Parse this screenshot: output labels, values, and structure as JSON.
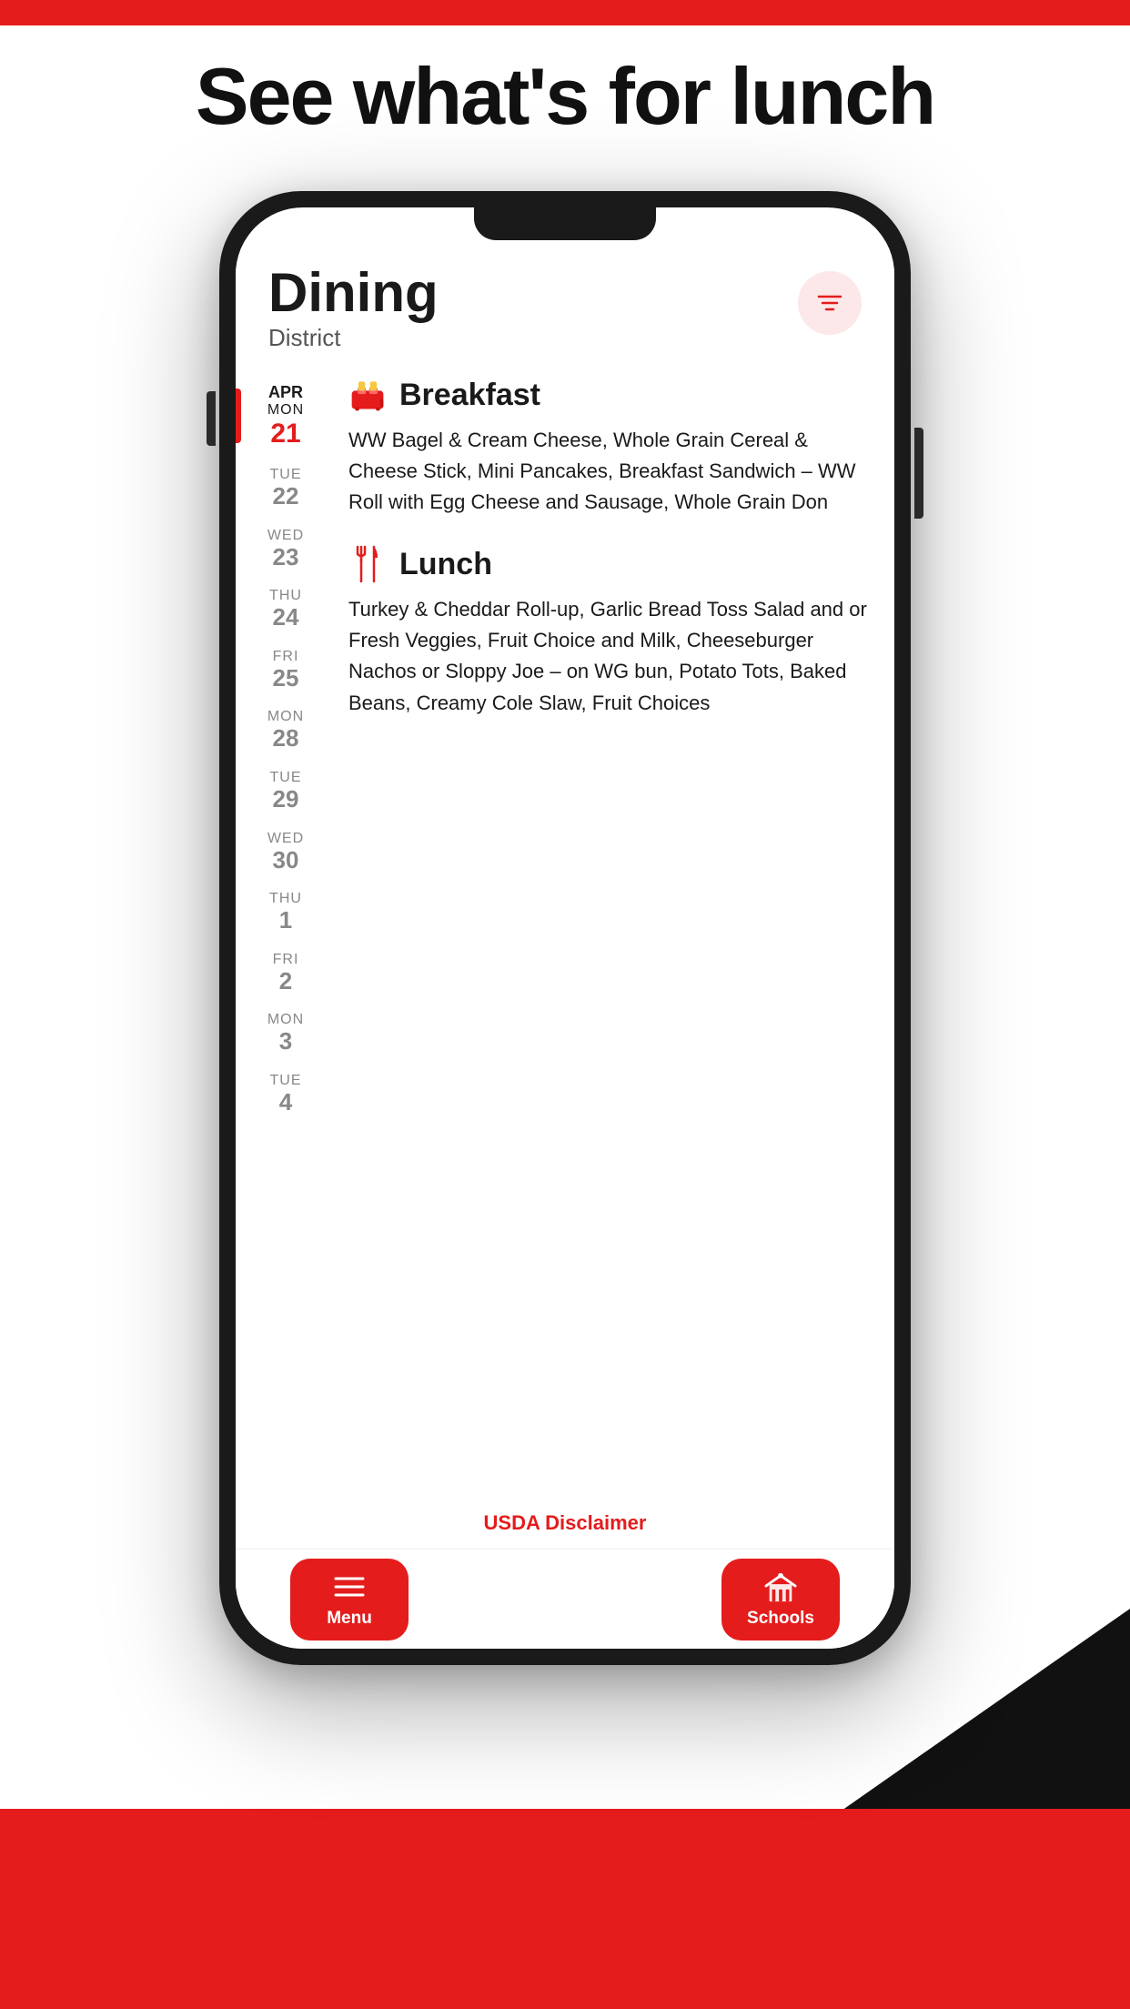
{
  "page": {
    "headline": "See what's for lunch",
    "top_bar_color": "#e41c1c"
  },
  "app": {
    "title": "Dining",
    "subtitle": "District",
    "filter_button_label": "Filter"
  },
  "dates": [
    {
      "id": "apr-mon-21",
      "month": "Apr",
      "day_abbr": "MON",
      "num": "21",
      "active": true
    },
    {
      "id": "tue-22",
      "month": "",
      "day_abbr": "TUE",
      "num": "22",
      "active": false
    },
    {
      "id": "wed-23",
      "month": "",
      "day_abbr": "WED",
      "num": "23",
      "active": false
    },
    {
      "id": "thu-24",
      "month": "",
      "day_abbr": "THU",
      "num": "24",
      "active": false
    },
    {
      "id": "fri-25",
      "month": "",
      "day_abbr": "FRI",
      "num": "25",
      "active": false
    },
    {
      "id": "mon-28",
      "month": "",
      "day_abbr": "MON",
      "num": "28",
      "active": false
    },
    {
      "id": "tue-29",
      "month": "",
      "day_abbr": "TUE",
      "num": "29",
      "active": false
    },
    {
      "id": "wed-30",
      "month": "",
      "day_abbr": "WED",
      "num": "30",
      "active": false
    },
    {
      "id": "thu-1",
      "month": "",
      "day_abbr": "THU",
      "num": "1",
      "active": false
    },
    {
      "id": "fri-2",
      "month": "",
      "day_abbr": "FRI",
      "num": "2",
      "active": false
    },
    {
      "id": "mon-3",
      "month": "",
      "day_abbr": "MON",
      "num": "3",
      "active": false
    },
    {
      "id": "tue-4",
      "month": "",
      "day_abbr": "TUE",
      "num": "4",
      "active": false
    }
  ],
  "meals": [
    {
      "id": "breakfast",
      "title": "Breakfast",
      "icon": "toaster",
      "description": "WW Bagel & Cream Cheese, Whole Grain Cereal & Cheese Stick, Mini Pancakes, Breakfast Sandwich – WW Roll with Egg Cheese and Sausage, Whole Grain Don"
    },
    {
      "id": "lunch",
      "title": "Lunch",
      "icon": "fork-knife",
      "description": "Turkey & Cheddar Roll-up, Garlic Bread Toss Salad and or Fresh Veggies, Fruit Choice and Milk, Cheeseburger Nachos or Sloppy Joe – on WG bun, Potato Tots, Baked Beans, Creamy Cole Slaw, Fruit Choices"
    }
  ],
  "footer": {
    "usda_disclaimer": "USDA Disclaimer",
    "nav_menu_label": "Menu",
    "nav_schools_label": "Schools"
  }
}
